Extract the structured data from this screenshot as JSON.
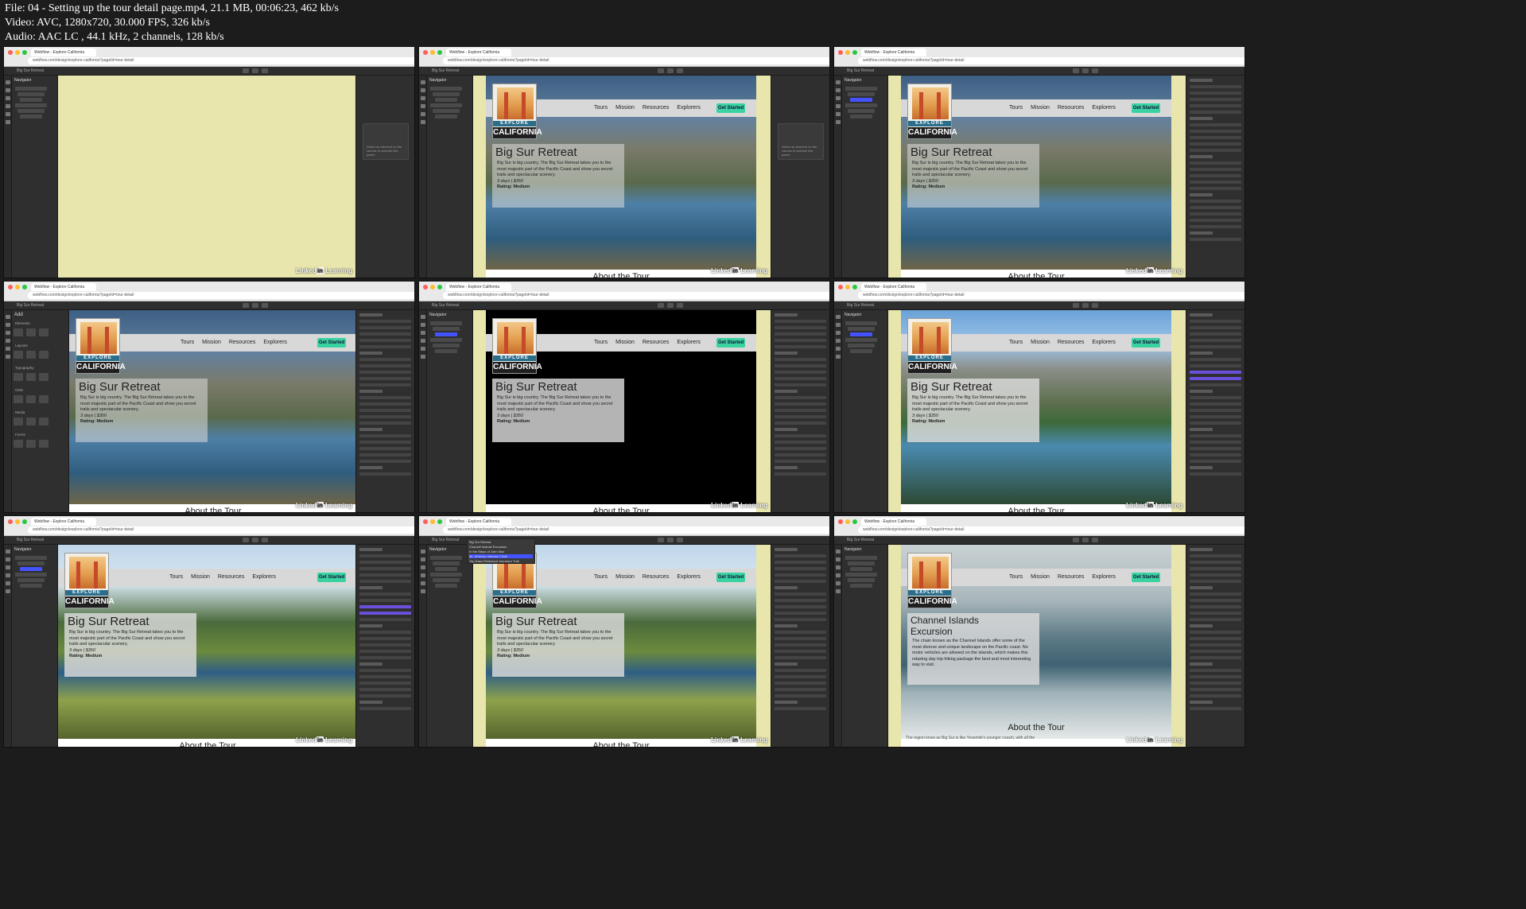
{
  "file_info": {
    "line1": "File: 04 - Setting up the tour detail page.mp4, 21.1 MB, 00:06:23, 462 kb/s",
    "line2": "Video: AVC, 1280x720, 30.000 FPS, 326 kb/s",
    "line3": "Audio: AAC LC , 44.1 kHz, 2 channels, 128 kb/s"
  },
  "browser": {
    "tab_title": "Webflow - Explore California",
    "url": "webflow.com/design/explore-california?pageId=tour-detail"
  },
  "site": {
    "logo_top": "EXPLORE",
    "logo_bottom": "CALIFORNIA",
    "nav": [
      "Tours",
      "Mission",
      "Resources",
      "Explorers"
    ],
    "cta": "Get Started",
    "about_heading": "About the Tour"
  },
  "tour_big_sur": {
    "title": "Big Sur Retreat",
    "description": "Big Sur is big country. The Big Sur Retreat takes you to the most majestic part of the Pacific Coast and show you secret trails and spectacular scenery.",
    "meta": "3 days | $350",
    "rating": "Rating: Medium"
  },
  "tour_channel": {
    "title": "Channel Islands Excursion",
    "description": "The chain known as the Channel Islands offer some of the most diverse and unique landscape on the Pacific coast. No motor vehicles are allowed on the islands, which makes this relaxing day trip hiking package the best and most interesting way to visit.",
    "about_text": "The region know as Big Sur is like Yosemite's younger cousin, with all the"
  },
  "panels": {
    "navigator": "Navigator",
    "add": "Add",
    "add_groups": [
      "Elements",
      "Layouts",
      "Typography",
      "CMS",
      "Media",
      "Forms"
    ],
    "empty_hint": "Select an element on the canvas to activate this panel.",
    "dropdown": [
      "Big Sur Retreat",
      "Channel Islands Excursion",
      "In the Steps of John Muir",
      "Mt. Whitney Ultimate Climb",
      "Top Dawn Redwood Journey's Trail"
    ]
  },
  "watermark": {
    "brand": "Linked",
    "in": "in",
    "suffix": " Learning"
  },
  "colors": {
    "canvas_bg": "#e8e6ad",
    "cta": "#3bd2a2",
    "select_blue": "#4353ff",
    "cms_purple": "#6b4fd8"
  }
}
